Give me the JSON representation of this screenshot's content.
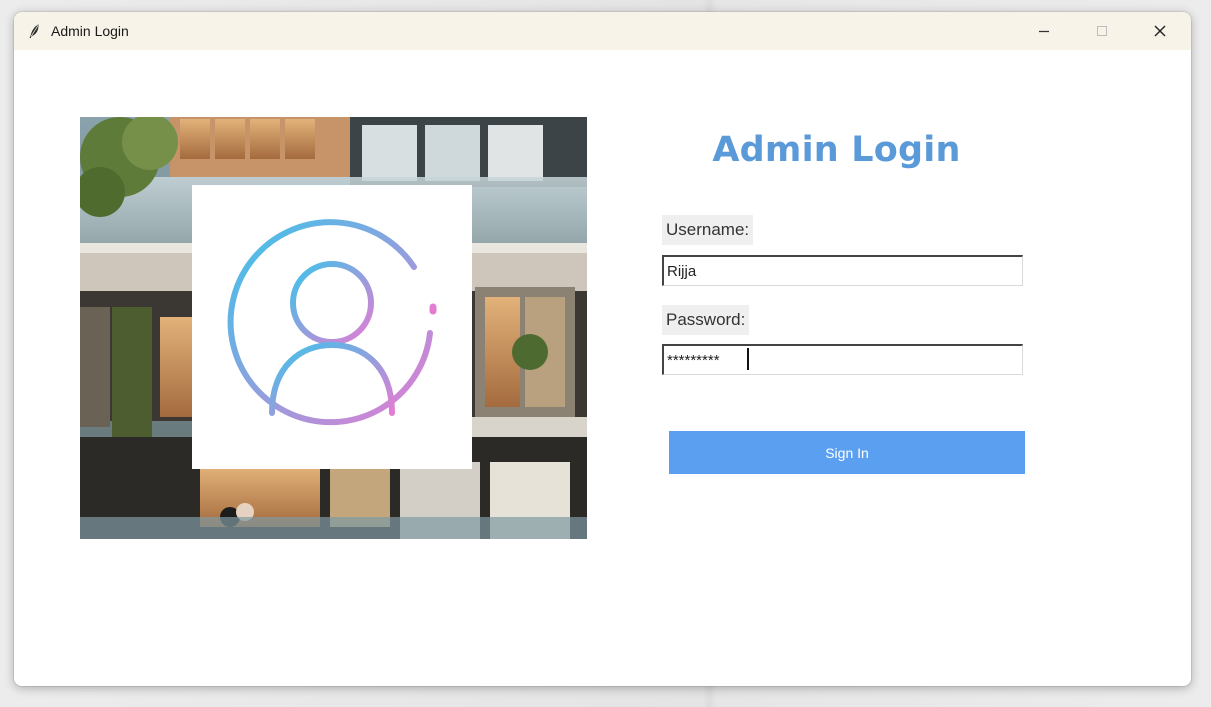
{
  "window": {
    "title": "Admin Login",
    "controls": {
      "minimize": "minimize-icon",
      "maximize": "maximize-icon",
      "close": "close-icon"
    }
  },
  "form": {
    "heading": "Admin Login",
    "username_label": "Username:",
    "username_value": "Rijja",
    "password_label": "Password:",
    "password_value": "*********",
    "sign_in_label": "Sign In"
  },
  "colors": {
    "heading": "#5b9ad9",
    "button": "#5ba0f0",
    "titlebar": "#f7f3e8",
    "avatar_gradient_start": "#3cc4ea",
    "avatar_gradient_end": "#e47cd2"
  },
  "icons": {
    "app": "feather-icon",
    "avatar": "user-avatar-icon"
  }
}
